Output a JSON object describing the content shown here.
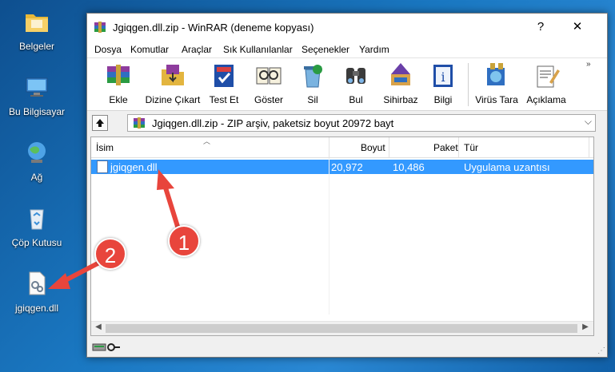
{
  "desktop": {
    "icons": [
      {
        "label": "Belgeler",
        "icon": "folder-icon"
      },
      {
        "label": "Bu Bilgisayar",
        "icon": "computer-icon"
      },
      {
        "label": "Ağ",
        "icon": "network-icon"
      },
      {
        "label": "Çöp Kutusu",
        "icon": "recycle-bin-icon"
      },
      {
        "label": "jgiqgen.dll",
        "icon": "dll-file-icon"
      }
    ]
  },
  "window": {
    "title": "Jgiqgen.dll.zip - WinRAR (deneme kopyası)",
    "help_label": "?",
    "close_label": "✕"
  },
  "menu": [
    "Dosya",
    "Komutlar",
    "Araçlar",
    "Sık Kullanılanlar",
    "Seçenekler",
    "Yardım"
  ],
  "toolbar": {
    "buttons": [
      {
        "label": "Ekle",
        "icon": "add-archive-icon"
      },
      {
        "label": "Dizine Çıkart",
        "icon": "extract-to-icon"
      },
      {
        "label": "Test Et",
        "icon": "test-icon"
      },
      {
        "label": "Göster",
        "icon": "view-icon"
      },
      {
        "label": "Sil",
        "icon": "delete-icon"
      },
      {
        "label": "Bul",
        "icon": "find-icon"
      },
      {
        "label": "Sihirbaz",
        "icon": "wizard-icon"
      },
      {
        "label": "Bilgi",
        "icon": "info-icon"
      },
      {
        "label": "Virüs Tara",
        "icon": "virus-scan-icon"
      },
      {
        "label": "Açıklama",
        "icon": "comment-icon"
      }
    ],
    "more": "»"
  },
  "address": {
    "path": "Jgiqgen.dll.zip - ZIP arşiv, paketsiz boyut 20972 bayt",
    "dropdown": "⌵"
  },
  "list": {
    "columns": [
      "İsim",
      "Boyut",
      "Paket",
      "Tür"
    ],
    "rows": [
      {
        "name": "jgiqgen.dll",
        "size": "20,972",
        "packed": "10,486",
        "type": "Uygulama uzantısı"
      }
    ]
  },
  "callouts": [
    "1",
    "2"
  ],
  "colors": {
    "selection": "#3399ff",
    "callout": "#e8453c"
  }
}
